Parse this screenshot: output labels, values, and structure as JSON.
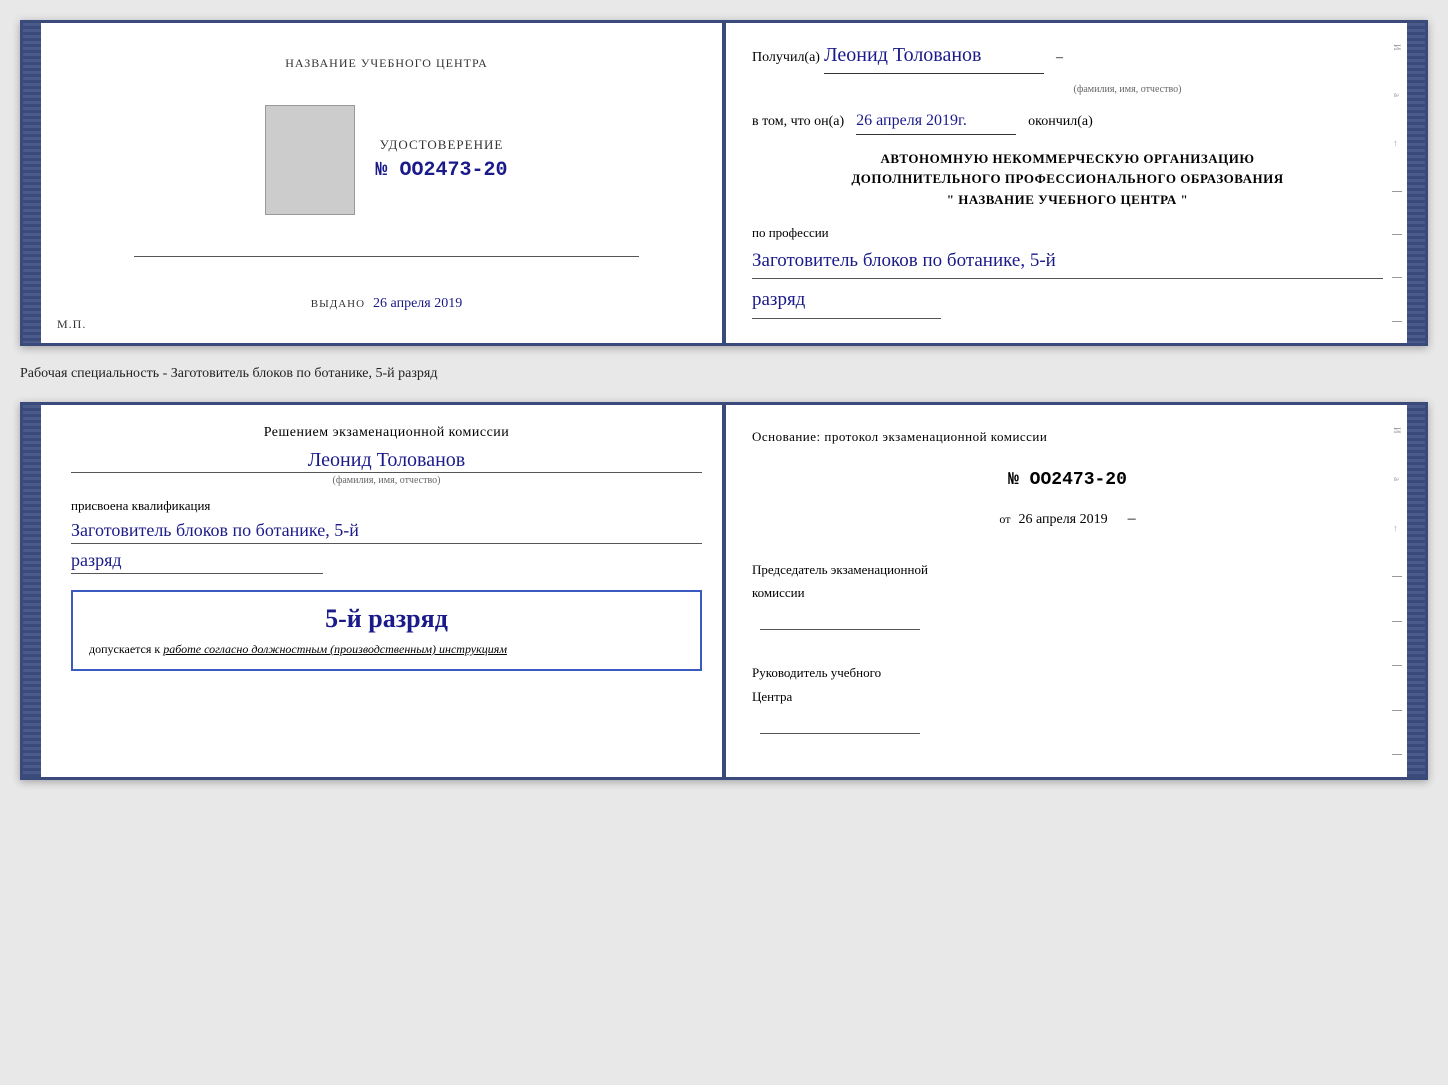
{
  "upper_document": {
    "left": {
      "title": "НАЗВАНИЕ УЧЕБНОГО ЦЕНТРА",
      "cert_label": "УДОСТОВЕРЕНИЕ",
      "cert_number": "№ OO2473-20",
      "issued_label": "Выдано",
      "issued_date": "26 апреля 2019",
      "mp_label": "М.П."
    },
    "right": {
      "received_label": "Получил(а)",
      "fio": "Леонид Толованов",
      "fio_hint": "(фамилия, имя, отчество)",
      "dash": "–",
      "in_that_label": "в том, что он(а)",
      "completion_date": "26 апреля 2019г.",
      "finished_label": "окончил(а)",
      "org_line1": "АВТОНОМНУЮ НЕКОММЕРЧЕСКУЮ ОРГАНИЗАЦИЮ",
      "org_line2": "ДОПОЛНИТЕЛЬНОГО ПРОФЕССИОНАЛЬНОГО ОБРАЗОВАНИЯ",
      "org_line3": "\"  НАЗВАНИЕ УЧЕБНОГО ЦЕНТРА  \"",
      "profession_label": "по профессии",
      "profession": "Заготовитель блоков по ботанике, 5-й",
      "razryad": "разряд"
    }
  },
  "specialty_info": "Рабочая специальность - Заготовитель блоков по ботанике, 5-й разряд",
  "lower_document": {
    "left": {
      "decision_label": "Решением экзаменационной комиссии",
      "fio": "Леонид Толованов",
      "fio_hint": "(фамилия, имя, отчество)",
      "assigned_label": "присвоена квалификация",
      "qualification": "Заготовитель блоков по ботанике, 5-й",
      "razryad": "разряд",
      "qualification_badge": "5-й разряд",
      "допускается_label": "допускается к",
      "допускается_text": "работе согласно должностным (производственным) инструкциям"
    },
    "right": {
      "basis_label": "Основание: протокол экзаменационной комиссии",
      "protocol_number": "№  OO2473-20",
      "from_label": "от",
      "from_date": "26 апреля 2019",
      "chairman_line1": "Председатель экзаменационной",
      "chairman_line2": "комиссии",
      "head_line1": "Руководитель учебного",
      "head_line2": "Центра"
    }
  }
}
